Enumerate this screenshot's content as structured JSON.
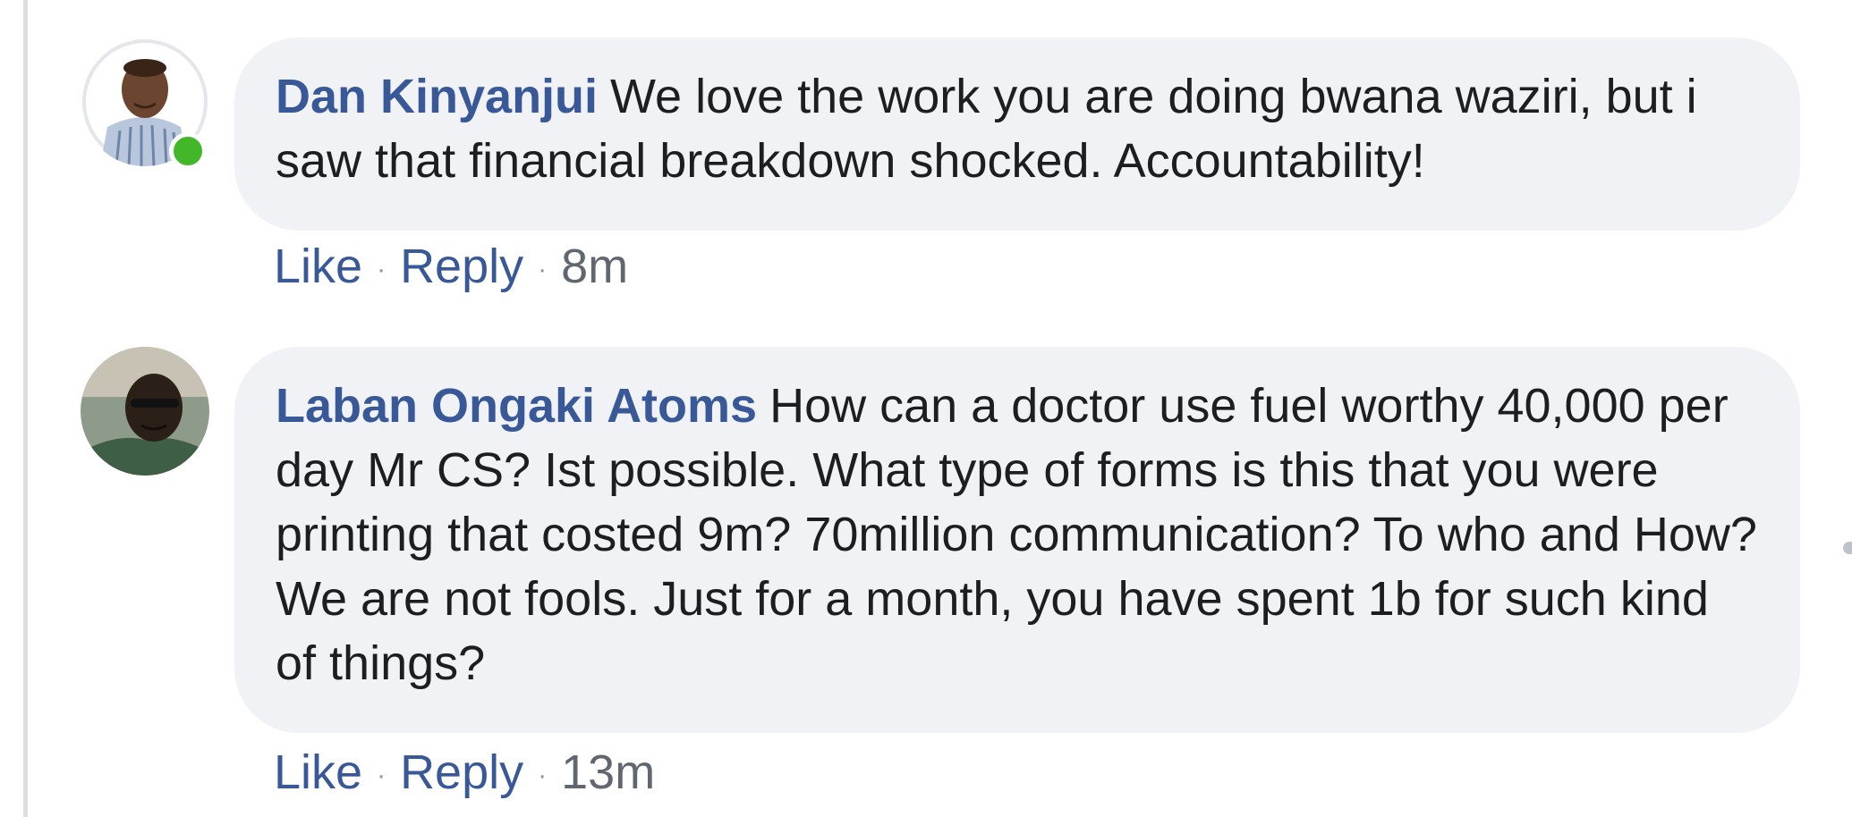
{
  "comments": [
    {
      "author": "Dan Kinyanjui",
      "text": "We love the work you are doing bwana waziri, but i saw that financial breakdown shocked. Accountability!",
      "like_label": "Like",
      "reply_label": "Reply",
      "separator": "·",
      "time": "8m",
      "online": true
    },
    {
      "author": "Laban Ongaki Atoms",
      "text": "How can a doctor use fuel worthy 40,000 per day Mr CS? Ist possible. What type of forms is this that you were printing that costed 9m? 70million communication? To who and How? We are not fools. Just for a month, you have spent 1b for such kind of things?",
      "like_label": "Like",
      "reply_label": "Reply",
      "separator": "·",
      "time": "13m",
      "online": false
    }
  ],
  "colors": {
    "link": "#385898",
    "bubble_bg": "#f0f2f5",
    "meta_text": "#606770",
    "online": "#42b72a"
  }
}
